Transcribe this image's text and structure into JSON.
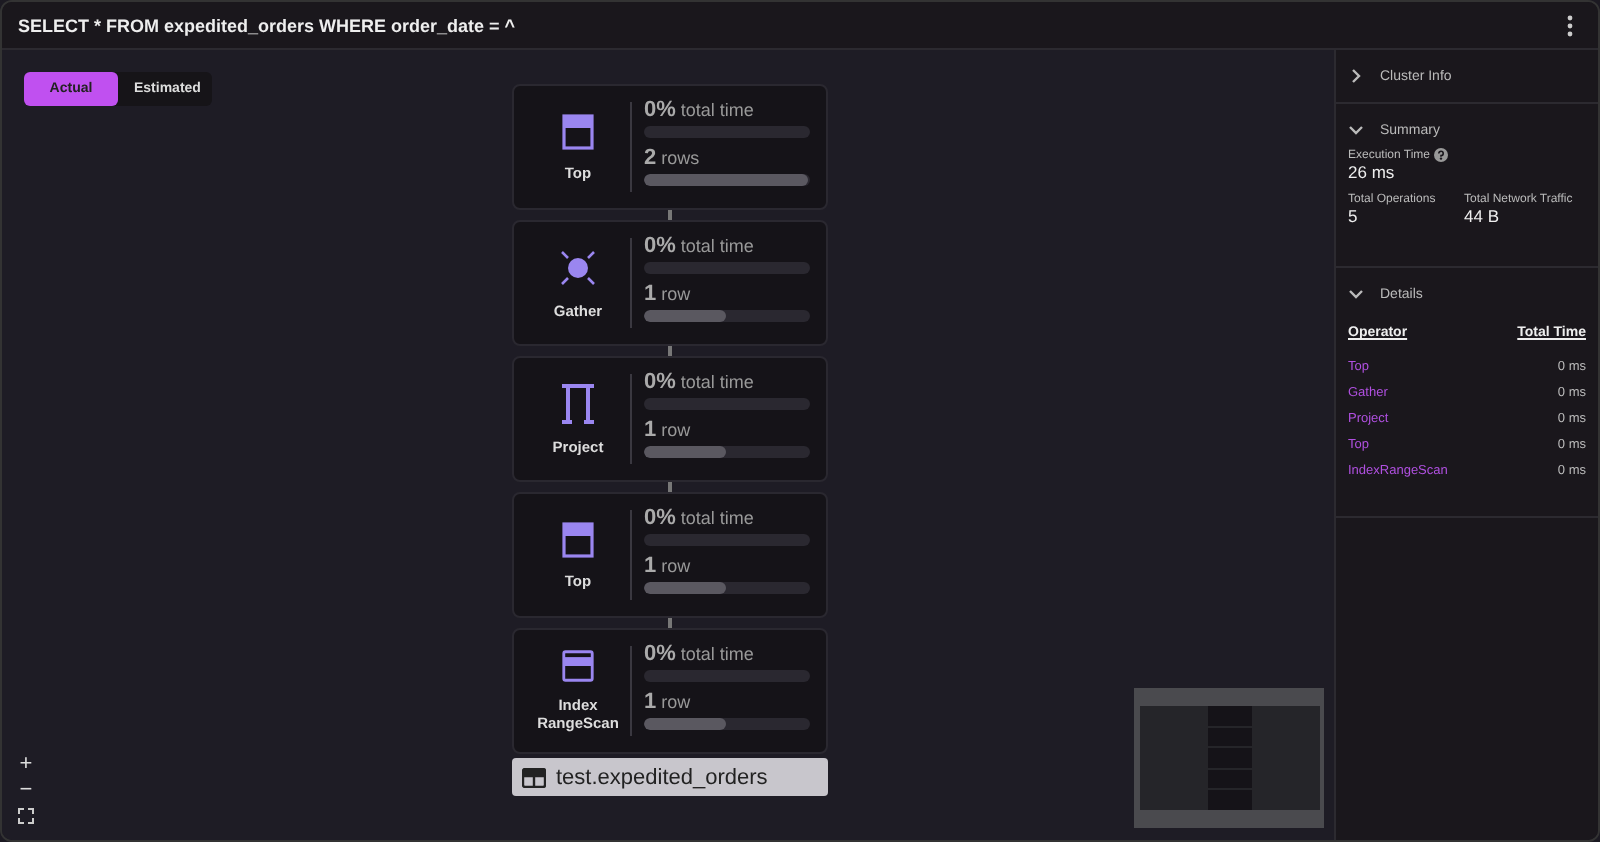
{
  "window": {
    "title": "SELECT * FROM expedited_orders WHERE order_date = ^"
  },
  "view_tabs": [
    {
      "label": "Actual",
      "selected": true
    },
    {
      "label": "Estimated",
      "selected": false
    }
  ],
  "plan_nodes": [
    {
      "kind": "top",
      "name": "Top",
      "metrics": [
        {
          "value": "0%",
          "label": "total time"
        },
        {
          "value": "2",
          "label": "rows",
          "level": 1
        }
      ]
    },
    {
      "kind": "gather",
      "name": "Gather",
      "metrics": [
        {
          "value": "0%",
          "label": "total time"
        },
        {
          "value": "1",
          "label": "row",
          "level": 0.5
        }
      ]
    },
    {
      "kind": "project",
      "name": "Project",
      "metrics": [
        {
          "value": "0%",
          "label": "total time"
        },
        {
          "value": "1",
          "label": "row",
          "level": 0.5
        }
      ]
    },
    {
      "kind": "top",
      "name": "Top",
      "metrics": [
        {
          "value": "0%",
          "label": "total time"
        },
        {
          "value": "1",
          "label": "row",
          "level": 0.5
        }
      ]
    },
    {
      "kind": "index",
      "name": "Index RangeScan",
      "metrics": [
        {
          "value": "0%",
          "label": "total time"
        },
        {
          "value": "1",
          "label": "row",
          "level": 0.5
        }
      ],
      "table": "test.expedited_orders"
    }
  ],
  "zoom_controls": [
    "+",
    "−"
  ],
  "sidebar": {
    "sections": [
      {
        "kind": "plain",
        "title": "Cluster Info",
        "expanded": false
      },
      {
        "kind": "summary",
        "title": "Summary",
        "expanded": true,
        "stats": [
          {
            "label": "Execution Time",
            "value": "26 ms",
            "help": true
          },
          {
            "label": "Total Operations",
            "value": "5",
            "help": false
          },
          {
            "label": "Total Network Traffic",
            "value": "44 B",
            "help": false
          }
        ]
      },
      {
        "kind": "details",
        "title": "Details",
        "expanded": true,
        "columns": [
          "Operator",
          "Total Time"
        ],
        "rows": [
          {
            "operator": "Top",
            "time": "0 ms"
          },
          {
            "operator": "Gather",
            "time": "0 ms"
          },
          {
            "operator": "Project",
            "time": "0 ms"
          },
          {
            "operator": "Top",
            "time": "0 ms"
          },
          {
            "operator": "IndexRangeScan",
            "time": "0 ms"
          }
        ]
      }
    ]
  }
}
